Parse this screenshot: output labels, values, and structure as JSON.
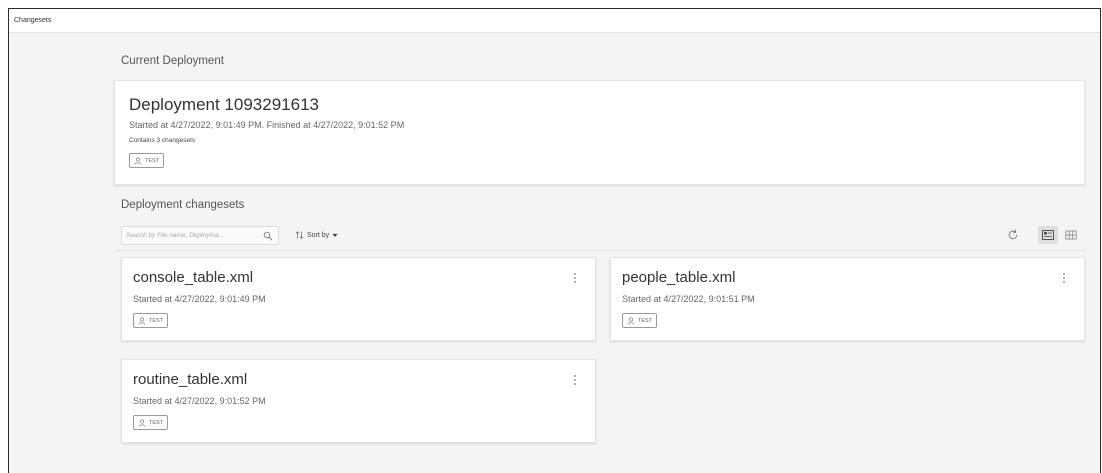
{
  "window": {
    "title": "Changesets"
  },
  "current_deployment": {
    "heading": "Current Deployment",
    "title": "Deployment 1093291613",
    "subtitle": "Started at 4/27/2022, 9:01:49 PM. Finished at 4/27/2022, 9:01:52 PM",
    "changeset_count": "Contains 3 changesets",
    "tag": "TEST"
  },
  "deployment_changesets": {
    "heading": "Deployment changesets",
    "search": {
      "placeholder": "Search by File name, Deployma...",
      "value": ""
    },
    "sort_label": "Sort by",
    "view_mode": "cards",
    "items": [
      {
        "name": "console_table.xml",
        "started": "Started at 4/27/2022, 9:01:49 PM",
        "tag": "TEST"
      },
      {
        "name": "people_table.xml",
        "started": "Started at 4/27/2022, 9:01:51 PM",
        "tag": "TEST"
      },
      {
        "name": "routine_table.xml",
        "started": "Started at 4/27/2022, 9:01:52 PM",
        "tag": "TEST"
      }
    ]
  },
  "icons": {
    "tag": "user-icon",
    "search": "search-icon",
    "sort": "sort-icon",
    "refresh": "refresh-icon",
    "card_view": "card-view-icon",
    "table_view": "table-view-icon",
    "menu": "kebab-menu-icon"
  },
  "colors": {
    "background": "#f4f4f4",
    "card": "#ffffff",
    "border": "#e4e4e4",
    "text": "#333333"
  }
}
